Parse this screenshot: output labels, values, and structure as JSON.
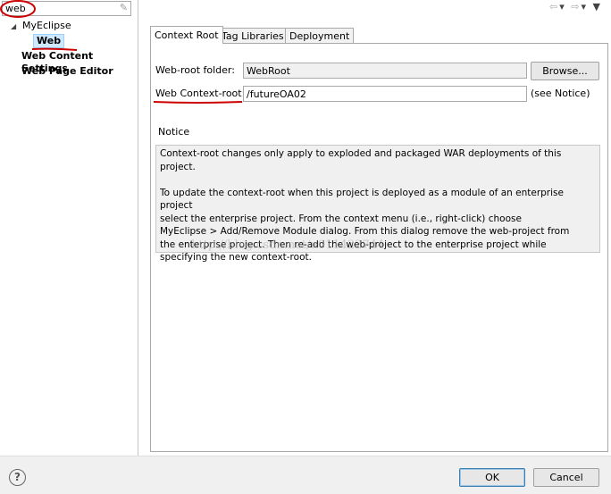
{
  "filter": {
    "value": "web"
  },
  "tree": {
    "root_label": "MyEclipse",
    "selected_label": "Web",
    "items": [
      "Web Content Settings",
      "Web Page Editor"
    ]
  },
  "toolbar": {
    "icons": [
      "back-arrow-icon",
      "dropdown-icon",
      "forward-arrow-icon",
      "dropdown-icon",
      "menu-icon"
    ]
  },
  "tabs": [
    "Context Root",
    "Tag Libraries",
    "Deployment"
  ],
  "form": {
    "webroot_label": "Web-root folder:",
    "webroot_value": "WebRoot",
    "browse_label": "Browse...",
    "context_label": "Web Context-root:",
    "context_value": "/futureOA02",
    "see_notice": "(see Notice)"
  },
  "notice": {
    "heading": "Notice",
    "text": "Context-root changes only apply to exploded and packaged WAR deployments of this project.\n\nTo update the context-root when this project is deployed as a module of an enterprise project\nselect the enterprise project. From the context menu (i.e., right-click) choose\nMyEclipse > Add/Remove Module dialog. From this dialog remove the web-project from\nthe enterprise project. Then re-add the web-project to the enterprise project while\nspecifying the new context-root."
  },
  "watermark": "http://blog.csdn.net/u011422744",
  "buttons": {
    "ok": "OK",
    "cancel": "Cancel"
  },
  "help_glyph": "?",
  "colors": {
    "annotation": "#cc0000",
    "selection": "#cde8ff"
  }
}
